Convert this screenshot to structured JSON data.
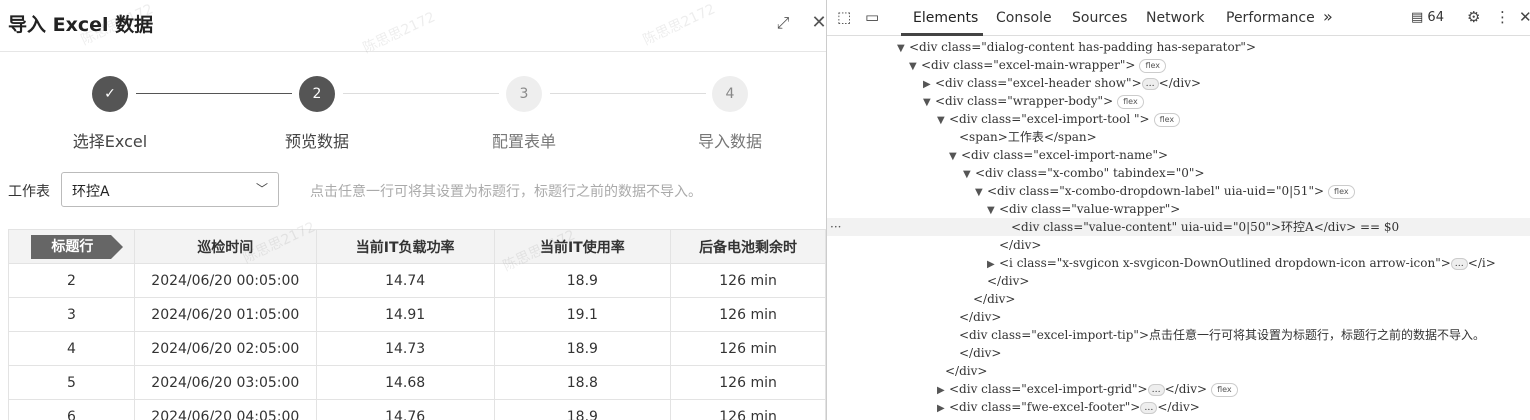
{
  "dialog": {
    "title": "导入 Excel 数据",
    "steps": [
      {
        "num": "✓",
        "label": "选择Excel",
        "state": "done"
      },
      {
        "num": "2",
        "label": "预览数据",
        "state": "active"
      },
      {
        "num": "3",
        "label": "配置表单",
        "state": "todo"
      },
      {
        "num": "4",
        "label": "导入数据",
        "state": "todo"
      }
    ],
    "worksheet_label": "工作表",
    "worksheet_value": "环控A",
    "tip": "点击任意一行可将其设置为标题行，标题行之前的数据不导入。",
    "header_tag": "标题行",
    "columns": [
      "巡检时间",
      "当前IT负载功率",
      "当前IT使用率",
      "后备电池剩余时"
    ],
    "rows": [
      [
        "2",
        "2024/06/20 00:05:00",
        "14.74",
        "18.9",
        "126 min"
      ],
      [
        "3",
        "2024/06/20 01:05:00",
        "14.91",
        "19.1",
        "126 min"
      ],
      [
        "4",
        "2024/06/20 02:05:00",
        "14.73",
        "18.9",
        "126 min"
      ],
      [
        "5",
        "2024/06/20 03:05:00",
        "14.68",
        "18.8",
        "126 min"
      ],
      [
        "6",
        "2024/06/20 04:05:00",
        "14.76",
        "18.9",
        "126 min"
      ]
    ],
    "watermark": "陈思思2172"
  },
  "devtools": {
    "tabs": [
      "Elements",
      "Console",
      "Sources",
      "Network",
      "Performance"
    ],
    "more": "»",
    "badge": "64",
    "lines": [
      "<div class=\"dialog-content has-padding has-separator\">",
      "<div class=\"excel-main-wrapper\">",
      "<div class=\"excel-header show\">",
      "<div class=\"wrapper-body\">",
      "<div class=\"excel-import-tool \">",
      "<span>工作表</span>",
      "<div class=\"excel-import-name\">",
      "<div class=\"x-combo\" tabindex=\"0\">",
      "<div class=\"x-combo-dropdown-label\" uia-uid=\"0|51\">",
      "<div class=\"value-wrapper\">",
      "<div class=\"value-content\" uia-uid=\"0|50\">环控A</div> == $0",
      "</div>",
      "<i class=\"x-svgicon x-svgicon-DownOutlined  dropdown-icon arrow-icon\">",
      "</div>",
      "</div>",
      "</div>",
      "<div class=\"excel-import-tip\">点击任意一行可将其设置为标题行，标题行之前的数据不导入。",
      "</div>",
      "</div>",
      "<div class=\"excel-import-grid\">",
      "<div class=\"fwe-excel-footer\">"
    ],
    "pill_flex": "flex",
    "close_tag": "</div>",
    "close_i": "</i>",
    "ellipsis": "…"
  }
}
